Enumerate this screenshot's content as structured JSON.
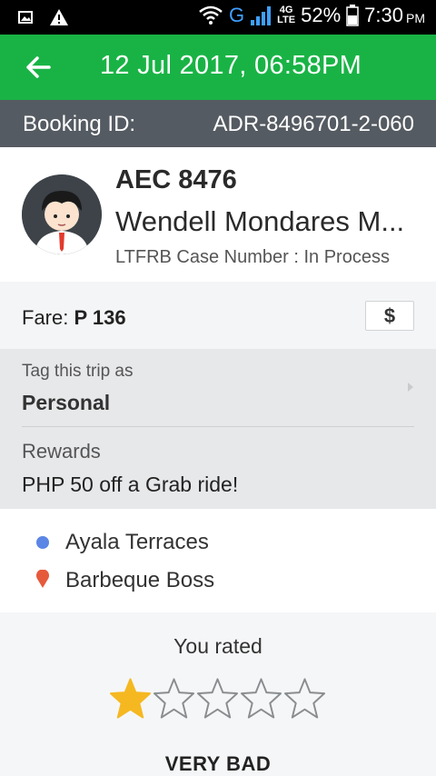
{
  "status_bar": {
    "network": "G",
    "network_type": "4G",
    "network_sub": "LTE",
    "battery": "52%",
    "time": "7:30",
    "ampm": "PM"
  },
  "header": {
    "title": "12 Jul 2017, 06:58PM"
  },
  "booking": {
    "label": "Booking ID:",
    "value": "ADR-8496701-2-060"
  },
  "driver": {
    "plate": "AEC 8476",
    "name": "Wendell Mondares M...",
    "ltfrb": "LTFRB Case Number : In Process"
  },
  "fare": {
    "label": "Fare: ",
    "amount": "P 136",
    "payment_symbol": "$"
  },
  "tag": {
    "label": "Tag this trip as",
    "value": "Personal"
  },
  "rewards": {
    "label": "Rewards",
    "value": "PHP 50 off a Grab ride!"
  },
  "route": {
    "pickup": "Ayala Terraces",
    "dropoff": "Barbeque Boss"
  },
  "rating": {
    "label": "You rated",
    "stars_total": 5,
    "stars_filled": 1,
    "verdict": "VERY BAD"
  },
  "colors": {
    "header_green": "#19b345",
    "booking_bar": "#555b62",
    "star_filled": "#f5b821",
    "pickup_dot": "#5b86e5",
    "dropoff_pin": "#e65a3c"
  }
}
